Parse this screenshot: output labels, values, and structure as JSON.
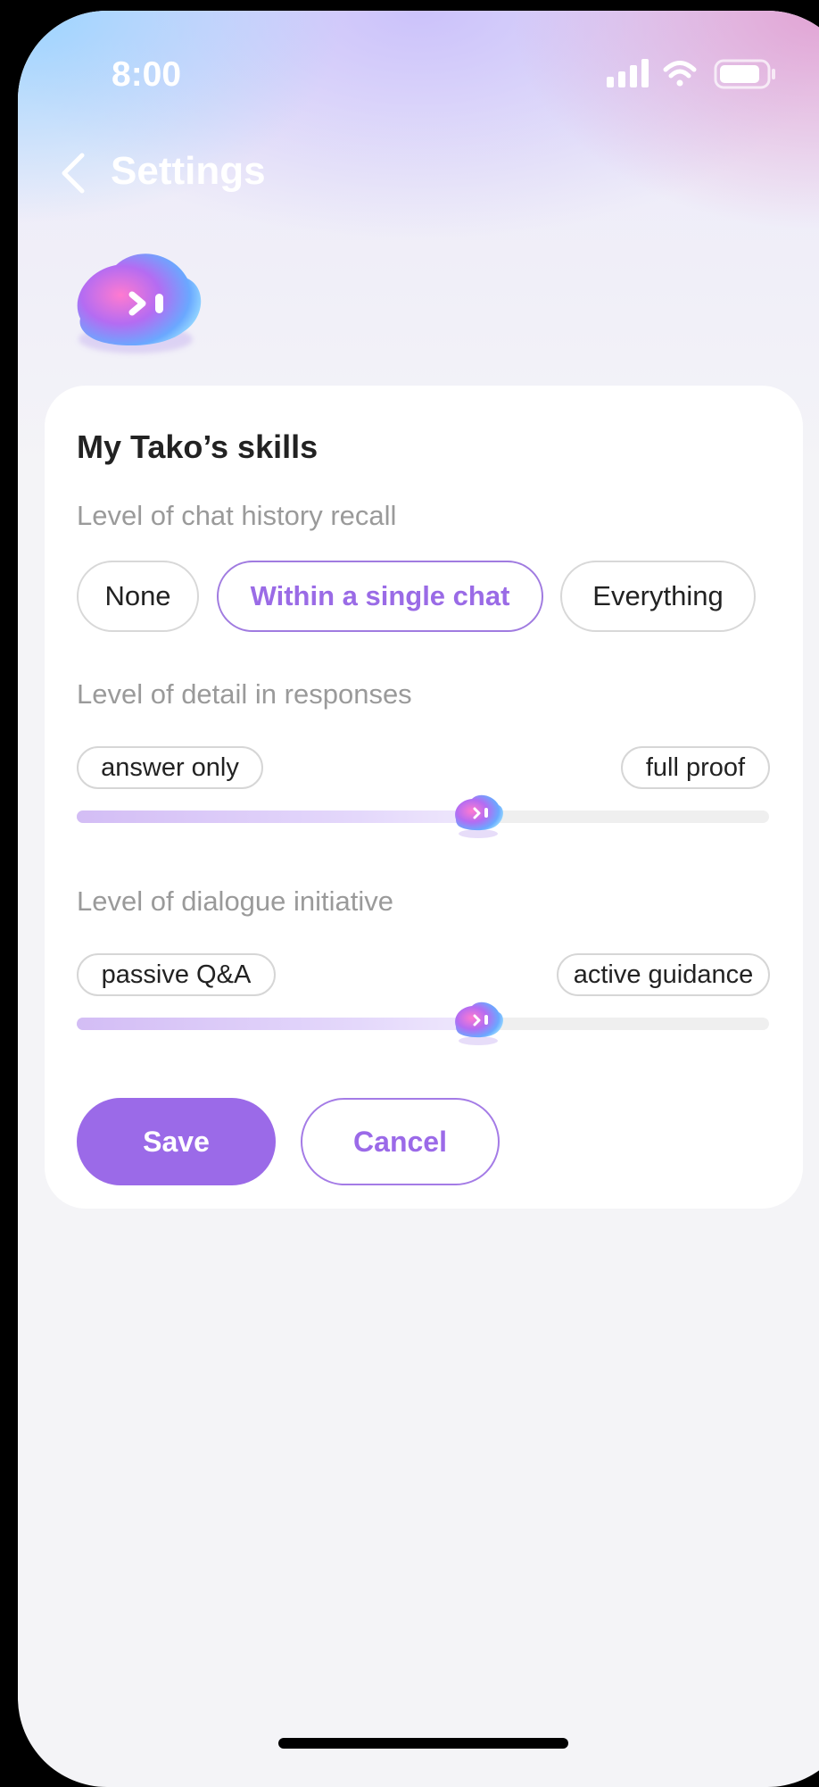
{
  "status_bar": {
    "time": "8:00"
  },
  "header": {
    "title": "Settings"
  },
  "card": {
    "title": "My Tako’s skills",
    "recall": {
      "label": "Level of chat history recall",
      "options": [
        "None",
        "Within a single chat",
        "Everything"
      ],
      "selected": "Within a single chat"
    },
    "detail": {
      "label": "Level of detail in responses",
      "min_label": "answer only",
      "max_label": "full proof",
      "value_fraction": 0.58
    },
    "initiative": {
      "label": "Level of dialogue initiative",
      "min_label": "passive Q&A",
      "max_label": "active guidance",
      "value_fraction": 0.58
    },
    "save_label": "Save",
    "cancel_label": "Cancel"
  },
  "colors": {
    "accent": "#9b6ae8",
    "card_bg": "#ffffff",
    "page_bg": "#f4f4f7"
  },
  "icons": [
    "back-chevron-icon",
    "signal-icon",
    "wifi-icon",
    "battery-icon",
    "tako-mascot-icon"
  ]
}
